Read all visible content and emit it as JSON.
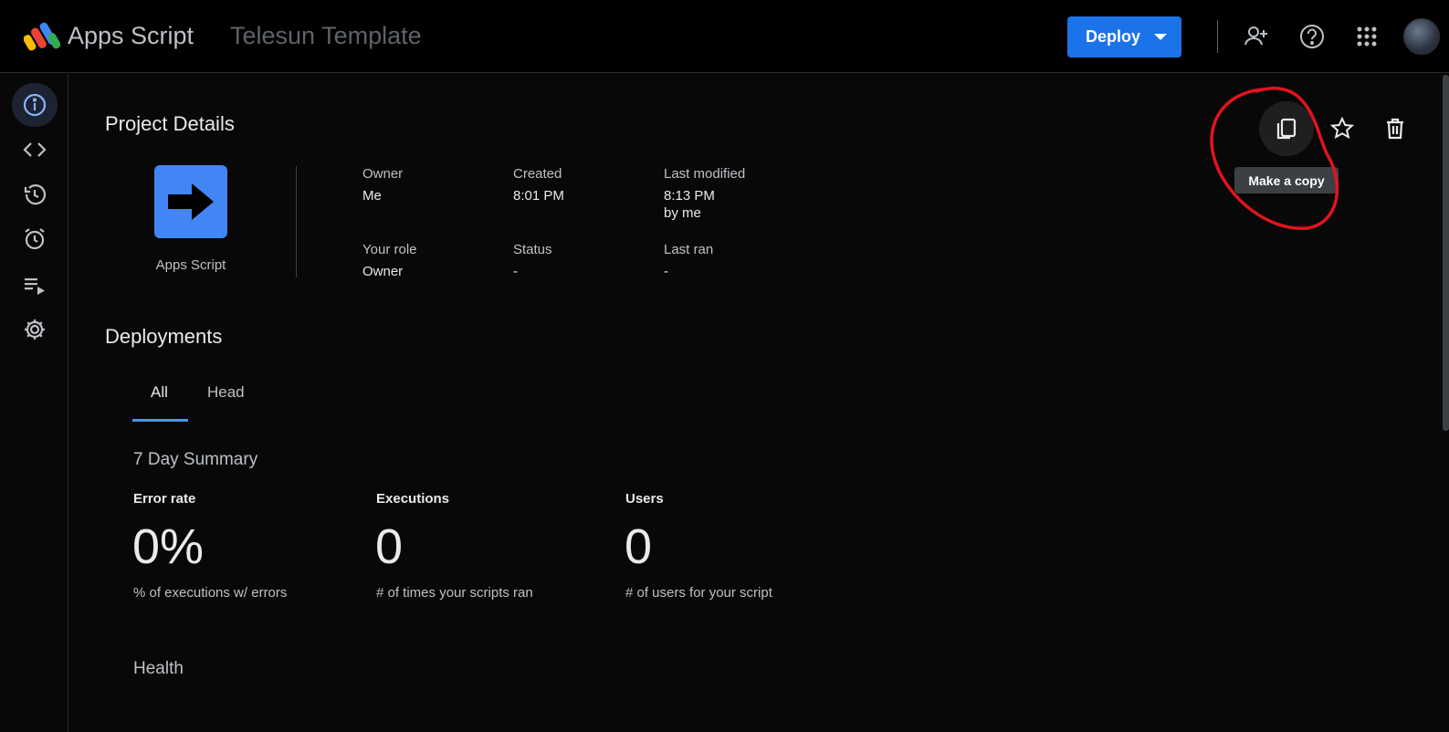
{
  "header": {
    "app_name": "Apps Script",
    "project_name": "Telesun Template",
    "deploy_label": "Deploy",
    "icons": [
      "add-person-icon",
      "help-icon",
      "apps-grid-icon"
    ]
  },
  "sidebar": {
    "items": [
      {
        "name": "overview",
        "icon": "info-icon",
        "active": true
      },
      {
        "name": "editor",
        "icon": "code-icon"
      },
      {
        "name": "executions-history",
        "icon": "history-icon"
      },
      {
        "name": "triggers",
        "icon": "alarm-icon"
      },
      {
        "name": "executions",
        "icon": "playlist-play-icon"
      },
      {
        "name": "settings",
        "icon": "gear-icon"
      }
    ]
  },
  "project_details": {
    "title": "Project Details",
    "tile_label": "Apps Script",
    "owner_label": "Owner",
    "owner_value": "Me",
    "created_label": "Created",
    "created_value": "8:01 PM",
    "modified_label": "Last modified",
    "modified_value": "8:13 PM",
    "modified_by": "by me",
    "role_label": "Your role",
    "role_value": "Owner",
    "status_label": "Status",
    "status_value": "-",
    "lastran_label": "Last ran",
    "lastran_value": "-",
    "tooltip": "Make a copy"
  },
  "deployments": {
    "title": "Deployments",
    "tabs": [
      {
        "label": "All",
        "selected": true
      },
      {
        "label": "Head",
        "selected": false
      }
    ],
    "summary_title": "7 Day Summary",
    "metrics": [
      {
        "label": "Error rate",
        "value": "0%",
        "caption": "% of executions w/ errors"
      },
      {
        "label": "Executions",
        "value": "0",
        "caption": "# of times your scripts ran"
      },
      {
        "label": "Users",
        "value": "0",
        "caption": "# of users for your script"
      }
    ],
    "health_title": "Health"
  },
  "colors": {
    "accent": "#1a73e8",
    "tile": "#4285f4",
    "annotation": "#e0141e"
  }
}
